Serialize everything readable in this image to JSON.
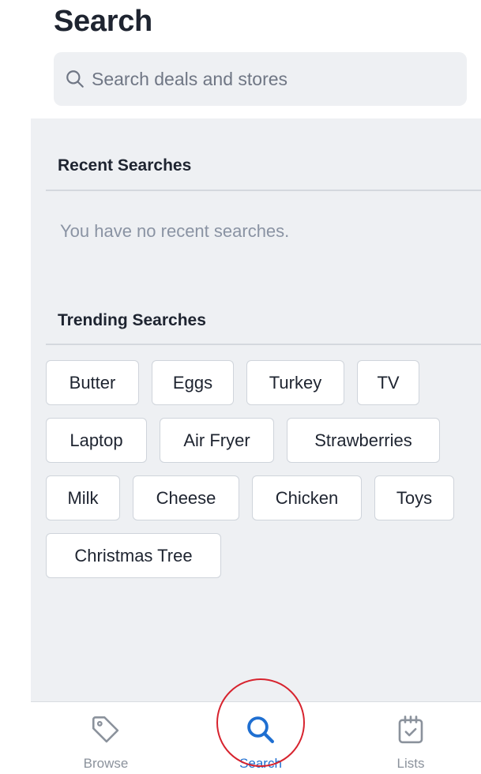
{
  "header": {
    "title": "Search"
  },
  "search": {
    "placeholder": "Search deals and stores",
    "icon": "search-icon"
  },
  "recent": {
    "title": "Recent Searches",
    "empty_text": "You have no recent searches."
  },
  "trending": {
    "title": "Trending Searches",
    "rows": [
      [
        "Butter",
        "Eggs",
        "Turkey",
        "TV"
      ],
      [
        "Laptop",
        "Air Fryer",
        "Strawberries"
      ],
      [
        "Milk",
        "Cheese",
        "Chicken",
        "Toys"
      ],
      [
        "Christmas Tree"
      ]
    ]
  },
  "tabs": [
    {
      "label": "Browse",
      "icon": "tag-icon"
    },
    {
      "label": "Search",
      "icon": "search-icon",
      "active": true
    },
    {
      "label": "Lists",
      "icon": "calendar-check-icon"
    }
  ],
  "colors": {
    "accent": "#1f6fd1",
    "highlight_circle": "#d7232e",
    "panel_bg": "#eef0f3"
  }
}
